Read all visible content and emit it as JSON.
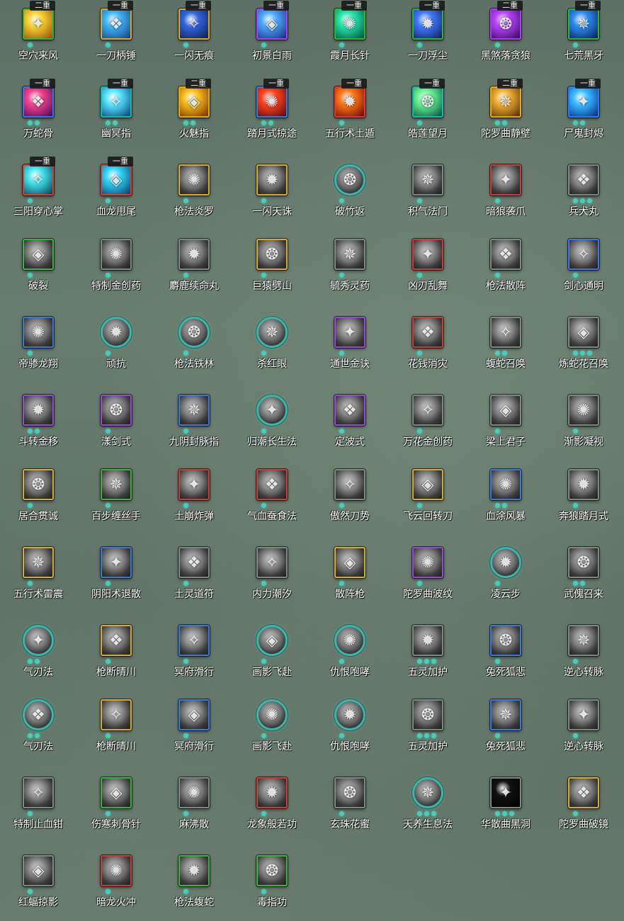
{
  "palette": {
    "gold": "#d4aa34",
    "green": "#3fae45",
    "blue": "#3b78d6",
    "purple": "#9b48d6",
    "red": "#c93c3c",
    "teal": "#2fb3a3",
    "gray": "#7d8783",
    "dot": "#48cdb8"
  },
  "rows": [
    [
      {
        "name": "空穴来风",
        "frame": "green",
        "badge": "二重",
        "pips": 1,
        "art": [
          "#f0d24a",
          "#8a4a1a"
        ],
        "icon": "swirl-icon"
      },
      {
        "name": "一刀柄锤",
        "frame": "gold",
        "badge": "一重",
        "pips": 1,
        "art": [
          "#4fb4e8",
          "#1a3a7a"
        ],
        "icon": "blade-icon"
      },
      {
        "name": "一闪无痕",
        "frame": "gold",
        "badge": "一重",
        "pips": 1,
        "art": [
          "#3a66c8",
          "#0e1a4a"
        ],
        "icon": "dash-icon"
      },
      {
        "name": "初景白雨",
        "frame": "purple",
        "badge": "一重",
        "pips": 1,
        "art": [
          "#5aa8f0",
          "#1a2a6a"
        ],
        "icon": "rain-icon"
      },
      {
        "name": "霞月长针",
        "frame": "green",
        "badge": "一重",
        "pips": 1,
        "art": [
          "#3ee0b0",
          "#0a4a3a"
        ],
        "icon": "needle-icon"
      },
      {
        "name": "一刀浮尘",
        "frame": "green",
        "badge": "一重",
        "pips": 1,
        "art": [
          "#4a7ae8",
          "#101a50"
        ],
        "icon": "slash-icon"
      },
      {
        "name": "黑煞落贪狼",
        "frame": "purple",
        "badge": "二重",
        "pips": 1,
        "art": [
          "#b04ae8",
          "#2a0a4a"
        ],
        "icon": "wolf-icon"
      },
      {
        "name": "七荒黑牙",
        "frame": "green",
        "badge": "一重",
        "pips": 1,
        "art": [
          "#3a8ae0",
          "#0a1a4a"
        ],
        "icon": "fang-icon"
      }
    ],
    [
      {
        "name": "万蛇骨",
        "frame": "blue",
        "badge": "一重",
        "pips": 2,
        "art": [
          "#e04a8a",
          "#3a0a4a"
        ],
        "icon": "snake-icon"
      },
      {
        "name": "幽冥指",
        "frame": "teal",
        "badge": "一重",
        "pips": 2,
        "art": [
          "#6ae0f8",
          "#0a3a6a"
        ],
        "icon": "finger-icon"
      },
      {
        "name": "火魅指",
        "frame": "gold",
        "badge": "二重",
        "pips": 2,
        "art": [
          "#f0c03a",
          "#6a2a0a"
        ],
        "icon": "fire-finger-icon"
      },
      {
        "name": "踏月式掠途",
        "frame": "blue",
        "badge": "一重",
        "pips": 2,
        "art": [
          "#e84a2a",
          "#4a0a0a"
        ],
        "icon": "moon-step-icon"
      },
      {
        "name": "五行术土遁",
        "frame": "red",
        "badge": "一重",
        "pips": 1,
        "art": [
          "#f07a2a",
          "#5a0a0a"
        ],
        "icon": "earth-icon"
      },
      {
        "name": "皓莲望月",
        "frame": "teal",
        "badge": "一重",
        "pips": 1,
        "art": [
          "#7af0a0",
          "#0a4a3a"
        ],
        "icon": "crescent-icon"
      },
      {
        "name": "陀罗曲静壁",
        "frame": "gold",
        "badge": "二重",
        "pips": 2,
        "art": [
          "#e8b04a",
          "#4a2a0a"
        ],
        "icon": "wall-icon"
      },
      {
        "name": "尸鬼封烬",
        "frame": "blue",
        "badge": "一重",
        "pips": 2,
        "art": [
          "#4ab8f8",
          "#0a2a6a"
        ],
        "icon": "ghost-fire-icon"
      }
    ],
    [
      {
        "name": "三阳穿心掌",
        "frame": "red",
        "badge": "一重",
        "pips": 1,
        "art": [
          "#5ae0e8",
          "#0a3a4a"
        ],
        "icon": "palm-icon"
      },
      {
        "name": "血龙甩尾",
        "frame": "red",
        "badge": "一重",
        "pips": 1,
        "art": [
          "#4ad0f0",
          "#0a3a5a"
        ],
        "icon": "dragon-tail-icon"
      },
      {
        "name": "枪法炎罗",
        "frame": "gold",
        "badge": "",
        "pips": 1,
        "art": null,
        "icon": "spear-icon"
      },
      {
        "name": "一闪天诛",
        "frame": "gold",
        "badge": "",
        "pips": 1,
        "art": null,
        "icon": "strike-icon"
      },
      {
        "name": "破竹返",
        "frame": "round",
        "badge": "",
        "pips": 1,
        "art": null,
        "icon": "bamboo-icon"
      },
      {
        "name": "积气法门",
        "frame": "gray",
        "badge": "",
        "pips": 1,
        "art": null,
        "icon": "qi-icon"
      },
      {
        "name": "暗狼袭爪",
        "frame": "red",
        "badge": "",
        "pips": 1,
        "art": null,
        "icon": "claw-icon"
      },
      {
        "name": "兵犬丸",
        "frame": "gray",
        "badge": "",
        "pips": 3,
        "art": null,
        "icon": "dog-pill-icon"
      }
    ],
    [
      {
        "name": "破裂",
        "frame": "green",
        "badge": "",
        "pips": 1,
        "art": null,
        "icon": "shatter-icon"
      },
      {
        "name": "特制金创药",
        "frame": "gray",
        "badge": "",
        "pips": 1,
        "art": null,
        "icon": "potion-icon"
      },
      {
        "name": "麝鹿续命丸",
        "frame": "gray",
        "badge": "",
        "pips": 1,
        "art": null,
        "icon": "pill-icon"
      },
      {
        "name": "巨猿劈山",
        "frame": "gold",
        "badge": "",
        "pips": 1,
        "art": null,
        "icon": "ape-icon"
      },
      {
        "name": "毓秀灵药",
        "frame": "gray",
        "badge": "",
        "pips": 1,
        "art": null,
        "icon": "gourd-icon"
      },
      {
        "name": "凶刃乱舞",
        "frame": "red",
        "badge": "",
        "pips": 1,
        "art": null,
        "icon": "blade-dance-icon"
      },
      {
        "name": "枪法散阵",
        "frame": "gray",
        "badge": "",
        "pips": 1,
        "art": null,
        "icon": "spear-sweep-icon"
      },
      {
        "name": "剑心通明",
        "frame": "blue",
        "badge": "",
        "pips": 1,
        "art": null,
        "icon": "sword-heart-icon"
      }
    ],
    [
      {
        "name": "帝骖龙翔",
        "frame": "blue",
        "badge": "",
        "pips": 1,
        "art": null,
        "icon": "dragon-fly-icon"
      },
      {
        "name": "顽抗",
        "frame": "round",
        "badge": "",
        "pips": 1,
        "art": null,
        "icon": "resist-icon"
      },
      {
        "name": "枪法铁林",
        "frame": "round",
        "badge": "",
        "pips": 1,
        "art": null,
        "icon": "iron-forest-icon"
      },
      {
        "name": "杀红眼",
        "frame": "round",
        "badge": "",
        "pips": 1,
        "art": null,
        "icon": "rage-eye-icon"
      },
      {
        "name": "通世金诀",
        "frame": "purple",
        "badge": "",
        "pips": 1,
        "art": null,
        "icon": "dice-icon"
      },
      {
        "name": "花钱消灾",
        "frame": "red",
        "badge": "",
        "pips": 1,
        "art": null,
        "icon": "coin-bag-icon"
      },
      {
        "name": "蝮蛇召唤",
        "frame": "gray",
        "badge": "",
        "pips": 2,
        "art": null,
        "icon": "viper-icon"
      },
      {
        "name": "炼蛇花召唤",
        "frame": "gray",
        "badge": "",
        "pips": 3,
        "art": null,
        "icon": "snake-flower-icon"
      }
    ],
    [
      {
        "name": "斗转金移",
        "frame": "purple",
        "badge": "",
        "pips": 2,
        "art": null,
        "icon": "spin-icon"
      },
      {
        "name": "漾剑式",
        "frame": "purple",
        "badge": "",
        "pips": 1,
        "art": null,
        "icon": "sword-wave-icon"
      },
      {
        "name": "九阴封脉指",
        "frame": "blue",
        "badge": "",
        "pips": 1,
        "art": null,
        "icon": "seal-finger-icon"
      },
      {
        "name": "归潮长生法",
        "frame": "round",
        "badge": "",
        "pips": 1,
        "art": null,
        "icon": "tide-icon"
      },
      {
        "name": "定波式",
        "frame": "purple",
        "badge": "",
        "pips": 1,
        "art": null,
        "icon": "calm-wave-icon"
      },
      {
        "name": "万花金创药",
        "frame": "gray",
        "badge": "",
        "pips": 1,
        "art": null,
        "icon": "flower-potion-icon"
      },
      {
        "name": "梁上君子",
        "frame": "gray",
        "badge": "",
        "pips": 1,
        "art": null,
        "icon": "thief-icon"
      },
      {
        "name": "渐影凝视",
        "frame": "gray",
        "badge": "",
        "pips": 1,
        "art": null,
        "icon": "gaze-icon"
      }
    ],
    [
      {
        "name": "居合贯诚",
        "frame": "gold",
        "badge": "",
        "pips": 1,
        "art": null,
        "icon": "iai-icon"
      },
      {
        "name": "百步缠丝手",
        "frame": "green",
        "badge": "",
        "pips": 1,
        "art": null,
        "icon": "silk-hand-icon"
      },
      {
        "name": "土崩炸弹",
        "frame": "red",
        "badge": "",
        "pips": 1,
        "art": null,
        "icon": "bomb-icon"
      },
      {
        "name": "气血蚕食法",
        "frame": "red",
        "badge": "",
        "pips": 1,
        "art": null,
        "icon": "drain-icon"
      },
      {
        "name": "傲然刀势",
        "frame": "gray",
        "badge": "",
        "pips": 1,
        "art": null,
        "icon": "blade-stance-icon"
      },
      {
        "name": "飞云回转刀",
        "frame": "gold",
        "badge": "",
        "pips": 1,
        "art": null,
        "icon": "cloud-blade-icon"
      },
      {
        "name": "血涂风暴",
        "frame": "blue",
        "badge": "",
        "pips": 2,
        "art": null,
        "icon": "storm-icon"
      },
      {
        "name": "奔狼踏月式",
        "frame": "gray",
        "badge": "",
        "pips": 1,
        "art": null,
        "icon": "wolf-run-icon"
      }
    ],
    [
      {
        "name": "五行术雷震",
        "frame": "gold",
        "badge": "",
        "pips": 1,
        "art": null,
        "icon": "thunder-icon"
      },
      {
        "name": "阴阳术退散",
        "frame": "blue",
        "badge": "",
        "pips": 1,
        "art": null,
        "icon": "yinyang-icon"
      },
      {
        "name": "土灵道符",
        "frame": "gray",
        "badge": "",
        "pips": 1,
        "art": null,
        "icon": "talisman-icon"
      },
      {
        "name": "内力潮汐",
        "frame": "gray",
        "badge": "",
        "pips": 1,
        "art": null,
        "icon": "inner-tide-icon"
      },
      {
        "name": "散阵枪",
        "frame": "gold",
        "badge": "",
        "pips": 1,
        "art": null,
        "icon": "scatter-spear-icon"
      },
      {
        "name": "陀罗曲波纹",
        "frame": "purple",
        "badge": "",
        "pips": 1,
        "art": null,
        "icon": "ripple-icon"
      },
      {
        "name": "凌云步",
        "frame": "round",
        "badge": "",
        "pips": 1,
        "art": null,
        "icon": "cloud-step-icon"
      },
      {
        "name": "武傀召来",
        "frame": "gray",
        "badge": "",
        "pips": 2,
        "art": null,
        "icon": "puppet-icon"
      }
    ],
    [
      {
        "name": "气刃法",
        "frame": "round",
        "badge": "",
        "pips": 2,
        "art": null,
        "icon": "air-blade-icon"
      },
      {
        "name": "枪断晴川",
        "frame": "gold",
        "badge": "",
        "pips": 1,
        "art": null,
        "icon": "spear-break-icon"
      },
      {
        "name": "冥府滑行",
        "frame": "blue",
        "badge": "",
        "pips": 1,
        "art": null,
        "icon": "underworld-glide-icon"
      },
      {
        "name": "画影飞赴",
        "frame": "round",
        "badge": "",
        "pips": 1,
        "art": null,
        "icon": "shadow-leap-icon"
      },
      {
        "name": "仇恨咆哮",
        "frame": "round",
        "badge": "",
        "pips": 1,
        "art": null,
        "icon": "roar-icon"
      },
      {
        "name": "五灵加护",
        "frame": "gray",
        "badge": "",
        "pips": 3,
        "art": null,
        "icon": "five-spirit-icon"
      },
      {
        "name": "兔死狐悲",
        "frame": "blue",
        "badge": "",
        "pips": 1,
        "art": null,
        "icon": "fox-icon"
      },
      {
        "name": "逆心转脉",
        "frame": "gray",
        "badge": "",
        "pips": 1,
        "art": null,
        "icon": "reverse-pulse-icon"
      }
    ],
    [
      {
        "name": "气刃法",
        "frame": "round",
        "badge": "",
        "pips": 2,
        "art": null,
        "icon": "air-blade-icon"
      },
      {
        "name": "枪断晴川",
        "frame": "gold",
        "badge": "",
        "pips": 1,
        "art": null,
        "icon": "spear-break-icon"
      },
      {
        "name": "冥府滑行",
        "frame": "blue",
        "badge": "",
        "pips": 1,
        "art": null,
        "icon": "underworld-glide-icon"
      },
      {
        "name": "画影飞赴",
        "frame": "round",
        "badge": "",
        "pips": 1,
        "art": null,
        "icon": "shadow-leap-icon"
      },
      {
        "name": "仇恨咆哮",
        "frame": "round",
        "badge": "",
        "pips": 1,
        "art": null,
        "icon": "roar-icon"
      },
      {
        "name": "五灵加护",
        "frame": "gray",
        "badge": "",
        "pips": 3,
        "art": null,
        "icon": "five-spirit-icon"
      },
      {
        "name": "兔死狐悲",
        "frame": "blue",
        "badge": "",
        "pips": 1,
        "art": null,
        "icon": "fox-icon"
      },
      {
        "name": "逆心转脉",
        "frame": "gray",
        "badge": "",
        "pips": 1,
        "art": null,
        "icon": "reverse-pulse-icon"
      }
    ],
    [
      {
        "name": "特制止血钳",
        "frame": "gray",
        "badge": "",
        "pips": 1,
        "art": null,
        "icon": "clamp-icon"
      },
      {
        "name": "伤寒刺骨针",
        "frame": "green",
        "badge": "",
        "pips": 1,
        "art": null,
        "icon": "cold-needle-icon"
      },
      {
        "name": "麻沸散",
        "frame": "gray",
        "badge": "",
        "pips": 1,
        "art": null,
        "icon": "powder-icon"
      },
      {
        "name": "龙象般若功",
        "frame": "red",
        "badge": "",
        "pips": 1,
        "art": null,
        "icon": "dragon-elephant-icon"
      },
      {
        "name": "玄珠花蜜",
        "frame": "gray",
        "badge": "",
        "pips": 1,
        "art": null,
        "icon": "nectar-icon"
      },
      {
        "name": "天养生息法",
        "frame": "round",
        "badge": "",
        "pips": 3,
        "art": null,
        "icon": "heal-aura-icon"
      },
      {
        "name": "华散曲黑洞",
        "frame": "gray",
        "badge": "",
        "pips": 3,
        "art": [
          "#111111",
          "#000000"
        ],
        "icon": "black-hole-icon"
      },
      {
        "name": "陀罗曲破镜",
        "frame": "gold",
        "badge": "",
        "pips": 1,
        "art": null,
        "icon": "mirror-icon"
      }
    ],
    [
      {
        "name": "红蝠掠影",
        "frame": "gray",
        "badge": "",
        "pips": 1,
        "art": null,
        "icon": "bat-icon"
      },
      {
        "name": "暗龙火冲",
        "frame": "red",
        "badge": "",
        "pips": 1,
        "art": null,
        "icon": "dark-dragon-icon"
      },
      {
        "name": "枪法蝮蛇",
        "frame": "green",
        "badge": "",
        "pips": 1,
        "art": null,
        "icon": "viper-spear-icon"
      },
      {
        "name": "毒指功",
        "frame": "green",
        "badge": "",
        "pips": 1,
        "art": null,
        "icon": "poison-finger-icon"
      }
    ]
  ]
}
